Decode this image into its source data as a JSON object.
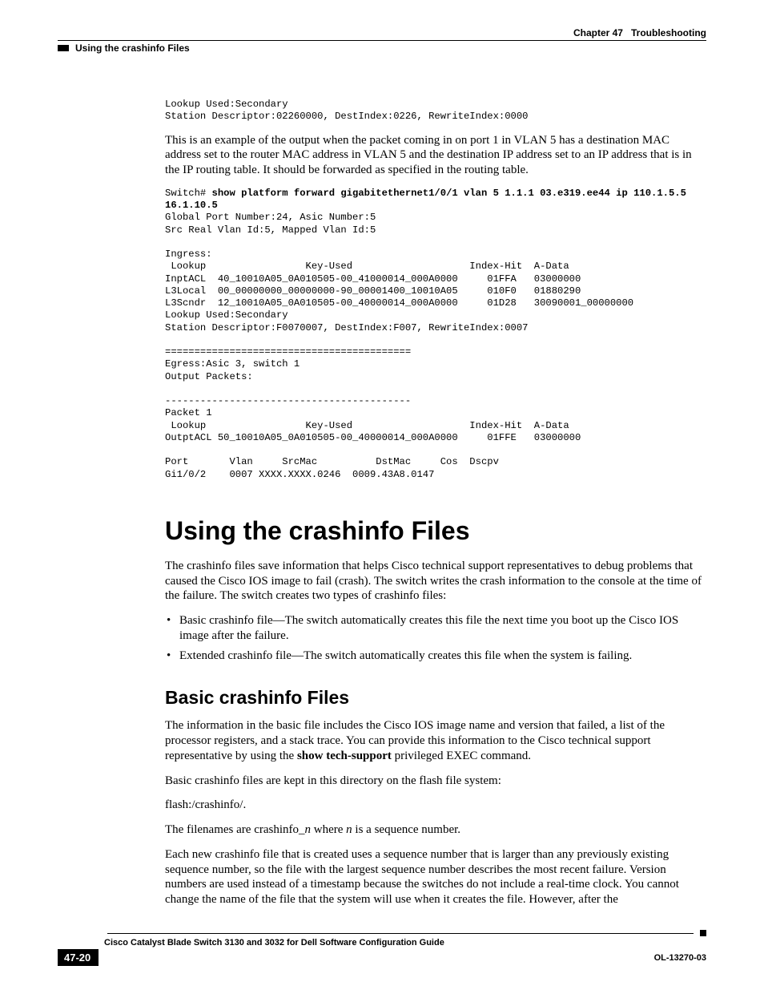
{
  "header": {
    "chapter_label": "Chapter 47",
    "chapter_title": "Troubleshooting",
    "running_head": "Using the crashinfo Files"
  },
  "pre1": "Lookup Used:Secondary\nStation Descriptor:02260000, DestIndex:0226, RewriteIndex:0000",
  "para1": "This is an example of the output when the packet coming in on port 1 in VLAN 5 has a destination MAC address set to the router MAC address in VLAN 5 and the destination IP address set to an IP address that is in the IP routing table. It should be forwarded as specified in the routing table.",
  "cmd_prefix": "Switch# ",
  "cmd_bold_line1": "show platform forward gigabitethernet1/0/1 vlan 5 1.1.1 03.e319.ee44 ip 110.1.5.5",
  "cmd_bold_line2": "16.1.10.5",
  "pre2_rest": "Global Port Number:24, Asic Number:5\nSrc Real Vlan Id:5, Mapped Vlan Id:5\n\nIngress:\n Lookup                 Key-Used                    Index-Hit  A-Data\nInptACL  40_10010A05_0A010505-00_41000014_000A0000     01FFA   03000000\nL3Local  00_00000000_00000000-90_00001400_10010A05     010F0   01880290\nL3Scndr  12_10010A05_0A010505-00_40000014_000A0000     01D28   30090001_00000000\nLookup Used:Secondary\nStation Descriptor:F0070007, DestIndex:F007, RewriteIndex:0007\n\n==========================================\nEgress:Asic 3, switch 1\nOutput Packets:\n\n------------------------------------------\nPacket 1\n Lookup                 Key-Used                    Index-Hit  A-Data\nOutptACL 50_10010A05_0A010505-00_40000014_000A0000     01FFE   03000000\n\nPort       Vlan     SrcMac          DstMac     Cos  Dscpv\nGi1/0/2    0007 XXXX.XXXX.0246  0009.43A8.0147",
  "h1": "Using the crashinfo Files",
  "para2": "The crashinfo files save information that helps Cisco technical support representatives to debug problems that caused the Cisco IOS image to fail (crash). The switch writes the crash information to the console at the time of the failure. The switch creates two types of crashinfo files:",
  "bullets": [
    "Basic crashinfo file—The switch automatically creates this file the next time you boot up the Cisco IOS image after the failure.",
    "Extended crashinfo file—The switch automatically creates this file when the system is failing."
  ],
  "h2": "Basic crashinfo Files",
  "para3_a": "The information in the basic file includes the Cisco IOS image name and version that failed, a list of the processor registers, and a stack trace. You can provide this information to the Cisco technical support representative by using the ",
  "para3_cmd": "show tech-support",
  "para3_b": " privileged EXEC command.",
  "para4": "Basic crashinfo files are kept in this directory on the flash file system:",
  "para5": "flash:/crashinfo/.",
  "para6_a": "The filenames are crashinfo_",
  "para6_n1": "n",
  "para6_b": " where ",
  "para6_n2": "n",
  "para6_c": " is a sequence number.",
  "para7": "Each new crashinfo file that is created uses a sequence number that is larger than any previously existing sequence number, so the file with the largest sequence number describes the most recent failure. Version numbers are used instead of a timestamp because the switches do not include a real-time clock. You cannot change the name of the file that the system will use when it creates the file. However, after the",
  "footer": {
    "book_title": "Cisco Catalyst Blade Switch 3130 and 3032 for Dell Software Configuration Guide",
    "page_num": "47-20",
    "doc_id": "OL-13270-03"
  }
}
